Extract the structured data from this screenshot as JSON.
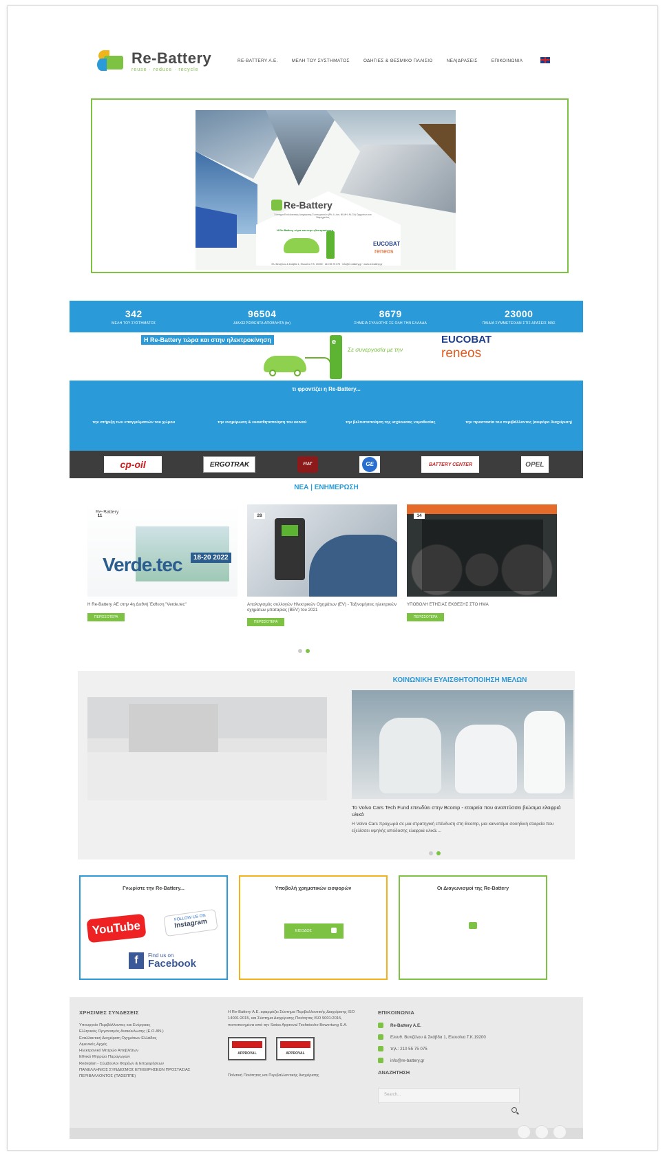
{
  "header": {
    "logo_title": "Re-Battery",
    "logo_tagline": "reuse · reduce · recycle",
    "nav": [
      "RE-BATTERY A.E.",
      "ΜΕΛΗ ΤΟΥ ΣΥΣΤΗΜΑΤΟΣ",
      "ΟΔΗΓΙΕΣ & ΘΕΣΜΙΚΟ ΠΛΑΙΣΙΟ",
      "ΝΕΑ|ΔΡΑΣΕΙΣ",
      "ΕΠΙΚΟΙΝΩΝΙΑ"
    ],
    "language_icon": "uk-flag-icon"
  },
  "hero": {
    "poster_logo": "Re-Battery",
    "poster_subtitle": "Σύστημα Εναλλακτικής Διαχείρισης Συσσωρευτών (Pb, Li-ion, Ni-MH, Ni-Cd) Οχημάτων και Βιομηχανίας",
    "poster_line": "Η Re-Battery τώρα και στην ηλεκτροκίνηση",
    "poster_partner1": "EUCOBAT",
    "poster_partner2": "reneos",
    "poster_info": "Ελ. Βενιζέλου & Σκάβδα 1, Ελευσίνα Τ.Κ. 19200 · 210 55 75 075 · info@re-battery.gr · www.re-battery.gr"
  },
  "stats": [
    {
      "value": "342",
      "label": "ΜΕΛΗ ΤΟΥ ΣΥΣΤΗΜΑΤΟΣ"
    },
    {
      "value": "96504",
      "label": "ΔΙΑΧΕΙΡΙΣΘΕΝΤΑ ΑΠΟΒΛΗΤΑ (tn)"
    },
    {
      "value": "8679",
      "label": "ΣΗΜΕΙΑ ΣΥΛΛΟΓΗΣ ΣΕ ΟΛΗ ΤΗΝ ΕΛΛΑΔΑ"
    },
    {
      "value": "23000",
      "label": "ΠΑΙΔΙΑ ΣΥΜΜΕΤΕΙΧΑΝ ΣΤΙΣ ΔΡΑΣΕΙΣ ΜΑΣ"
    }
  ],
  "emobility": {
    "headline": "Η Re-Battery τώρα και στην ηλεκτροκίνηση",
    "charger_letter": "e",
    "cooperation": "Σε συνεργασία με την",
    "partner1": "EUCOBAT",
    "partner2": "reneos"
  },
  "care": {
    "title": "τι φροντίζει η Re-Battery...",
    "items": [
      "την στήριξη των επαγγελματιών του χώρου",
      "την ενημέρωση & ευαισθητοποίηση του κοινού",
      "την βελτιστοποίηση της ισχύουσας νομοθεσίας",
      "την προστασία του περιβάλλοντος (αειφόρο διαχείριση)"
    ]
  },
  "partners": [
    "cp-oil",
    "ERGOTRAK",
    "FIAT",
    "GE",
    "BATTERY CENTER",
    "OPEL"
  ],
  "news": {
    "title": "ΝΕΑ | ΕΝΗΜΕΡΩΣΗ",
    "items": [
      {
        "day": "11",
        "text": "Η Re-Battery ΑΕ στην 4η Διεθνή Έκθεση \"Verde.tec\"",
        "button": "ΠΕΡΙΣΣΟΤΕΡΑ",
        "img_logo": "Re-Battery",
        "img_title": "Verde.tec",
        "img_dates": "18-20 2022"
      },
      {
        "day": "28",
        "text": "Απολογισμός συλλογών Ηλεκτρικών Οχημάτων (EV) - Ταξινομήσεις ηλεκτρικών οχημάτων μπαταρίας (BEV) του 2021",
        "button": "ΠΕΡΙΣΣΟΤΕΡΑ"
      },
      {
        "day": "14",
        "text": "ΥΠΟΒΟΛΗ ΕΤΗΣΙΑΣ ΕΚΘΕΣΗΣ ΣΤΟ ΗΜΑ",
        "button": "ΠΕΡΙΣΣΟΤΕΡΑ"
      }
    ]
  },
  "social": {
    "title": "ΚΟΙΝΩΝΙΚΗ ΕΥΑΙΣΘΗΤΟΠΟΙΗΣΗ ΜΕΛΩΝ",
    "headline": "Το Volvo Cars Tech Fund επενδύει στην Bcomp - εταιρεία που αναπτύσσει βιώσιμα ελαφριά υλικά",
    "text": "Η Volvo Cars προχωρά σε μια στρατηγική επένδυση στη Bcomp, μια καινοτόμο σουηδική εταιρεία που εξελίσσει υψηλής απόδοσης ελαφριά υλικά...."
  },
  "boxes": {
    "social_title": "Γνωρίστε την Re-Battery...",
    "youtube": "YouTube",
    "instagram_top": "FOLLOW US ON",
    "instagram": "Instagram",
    "facebook_top": "Find us on",
    "facebook": "Facebook",
    "submit_title": "Υποβολή χρηματικών εισφορών",
    "enter_button": "ΕΙΣΟΔΟΣ",
    "tender_title": "Οι Διαγωνισμοί της Re-Battery"
  },
  "footer": {
    "links_title": "ΧΡΗΣΙΜΕΣ ΣΥΝΔΕΣΕΙΣ",
    "links": [
      "Υπουργείο Περιβάλλοντος και Ενέργειας",
      "Ελληνικός Οργανισμός Ανακύκλωσης (Ε.Ο.ΑΝ.)",
      "Εναλλακτική Διαχείριση Οχημάτων Ελλάδας",
      "Λιμενικές Αρχές",
      "Ηλεκτρονικό Μητρώο Αποβλήτων",
      "Εθνικό Μητρώο Παραγωγών",
      "Redeplan - Σύμβουλοι Φορέων & Επιχειρήσεων",
      "ΠΑΝΕΛΛΗΝΙΟΣ ΣΥΝΔΕΣΜΟΣ ΕΠΙΧΕΙΡΗΣΕΩΝ ΠΡΟΣΤΑΣΙΑΣ ΠΕΡΙΒΑΛΛΟΝΤΟΣ (ΠΑΣΕΠΠΕ)"
    ],
    "iso_text": "Η Re-Battery Α.Ε. εφαρμόζει Σύστημα Περιβαλλοντικής Διαχείρισης ISO 14001:2015, και Σύστημα Διαχείρισης Ποιότητας ISO 9001:2015, πιστοποιημένα από την Swiss Approval Technische Bewertung S.A.",
    "swiss1": "SWISS",
    "swiss2": "SWISS",
    "swiss_sub": "APPROVAL",
    "policy": "Πολιτική Ποιότητας και Περιβαλλοντικής Διαχείρισης",
    "contact_title": "ΕΠΙΚΟΙΝΩΝΙΑ",
    "company": "Re-Battery A.E.",
    "address": "Ελευθ. Βενιζέλου & Σκάβδα 1, Ελευσίνα Τ.Κ.19200",
    "phone": "τηλ.: 210 55 75 075",
    "email": "info@re-battery.gr",
    "search_title": "ΑΝΑΖΗΤΗΣΗ",
    "search_placeholder": "Search..."
  },
  "colors": {
    "blue": "#2a9ad8",
    "green": "#7dc242",
    "orange": "#f3b11b"
  }
}
